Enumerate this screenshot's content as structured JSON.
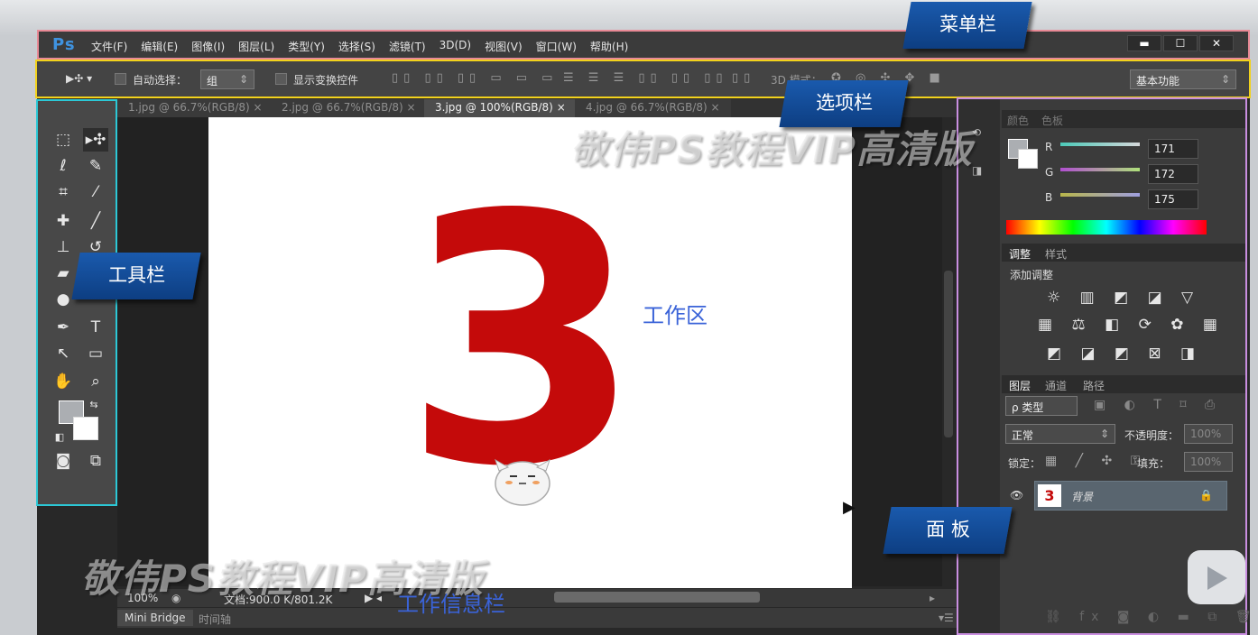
{
  "app": {
    "logo": "Ps",
    "menu": [
      "文件(F)",
      "编辑(E)",
      "图像(I)",
      "图层(L)",
      "类型(Y)",
      "选择(S)",
      "滤镜(T)",
      "3D(D)",
      "视图(V)",
      "窗口(W)",
      "帮助(H)"
    ],
    "window_controls": [
      "▬",
      "☐",
      "✕"
    ]
  },
  "options": {
    "auto_select_label": "自动选择：",
    "auto_select_value": "组",
    "show_transform_label": "显示变换控件",
    "mode_3d_label": "3D 模式：",
    "workspace_value": "基本功能"
  },
  "tabs": [
    "1.jpg @ 66.7%(RGB/8)",
    "2.jpg @ 66.7%(RGB/8)",
    "3.jpg @ 100%(RGB/8)",
    "4.jpg @ 66.7%(RGB/8)"
  ],
  "tab_close": "×",
  "canvas": {
    "numeral": "3"
  },
  "status": {
    "zoom": "100%",
    "doc": "文档:900.0 K/801.2K"
  },
  "bottom_tabs": [
    "Mini Bridge",
    "时间轴"
  ],
  "color_panel": {
    "tabs": [
      "颜色",
      "色板"
    ],
    "r_label": "R",
    "g_label": "G",
    "b_label": "B",
    "r": "171",
    "g": "172",
    "b": "175"
  },
  "adjust_panel": {
    "tabs": [
      "调整",
      "样式"
    ],
    "title": "添加调整"
  },
  "layers_panel": {
    "tabs": [
      "图层",
      "通道",
      "路径"
    ],
    "filter": "ρ 类型",
    "blend": "正常",
    "opacity_label": "不透明度：",
    "opacity": "100%",
    "lock_label": "锁定：",
    "fill_label": "填充：",
    "fill": "100%",
    "layer_name": "背景",
    "layer_thumb": "3"
  },
  "callouts": {
    "menubar": "菜单栏",
    "options": "选项栏",
    "toolbar": "工具栏",
    "panels": "面 板",
    "work": "工作区",
    "info": "工作信息栏"
  },
  "watermark": "敬伟PS教程VIP高清版",
  "colors": {
    "foreground": "#abaeb2",
    "numeral": "#c40a0a",
    "menubar_frame": "#e98a96",
    "options_frame": "#f2d21c",
    "toolbar_frame": "#2cc8d6",
    "panels_frame": "#c98ee0"
  }
}
